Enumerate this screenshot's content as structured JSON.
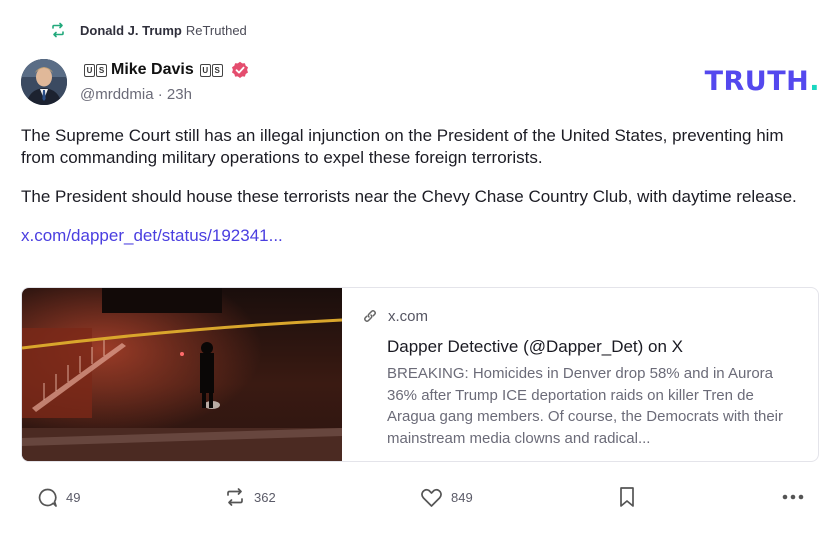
{
  "retruth": {
    "icon": "retruth-icon",
    "author": "Donald J. Trump",
    "label": "ReTruthed"
  },
  "post": {
    "author_name": "Mike Davis",
    "flag_left": "US",
    "flag_right": "US",
    "handle": "@mrddmia",
    "separator": "·",
    "time": "23h",
    "paragraph_1": "The Supreme Court still has an illegal injunction on the President of the United States, preventing him from commanding military operations to expel these foreign terrorists.",
    "paragraph_2": "The President should house these terrorists near the Chevy Chase Country Club, with daytime release.",
    "link_text": "x.com/dapper_det/status/192341..."
  },
  "logo": {
    "text": "TRUTH",
    "dot": ".",
    "color": "#5448ee",
    "dot_color": "#1ad7c0"
  },
  "card": {
    "domain": "x.com",
    "title": "Dapper Detective (@Dapper_Det) on X",
    "description": "BREAKING: Homicides in Denver drop 58% and in Aurora 36% after Trump ICE deportation raids on killer Tren de Aragua gang members. Of course, the Democrats with their mainstream media clowns and radical..."
  },
  "actions": {
    "replies": "49",
    "retruths": "362",
    "likes": "849"
  },
  "colors": {
    "link": "#4a3ee0",
    "verified": "#e44d6e",
    "retruth_icon": "#23a97c"
  }
}
